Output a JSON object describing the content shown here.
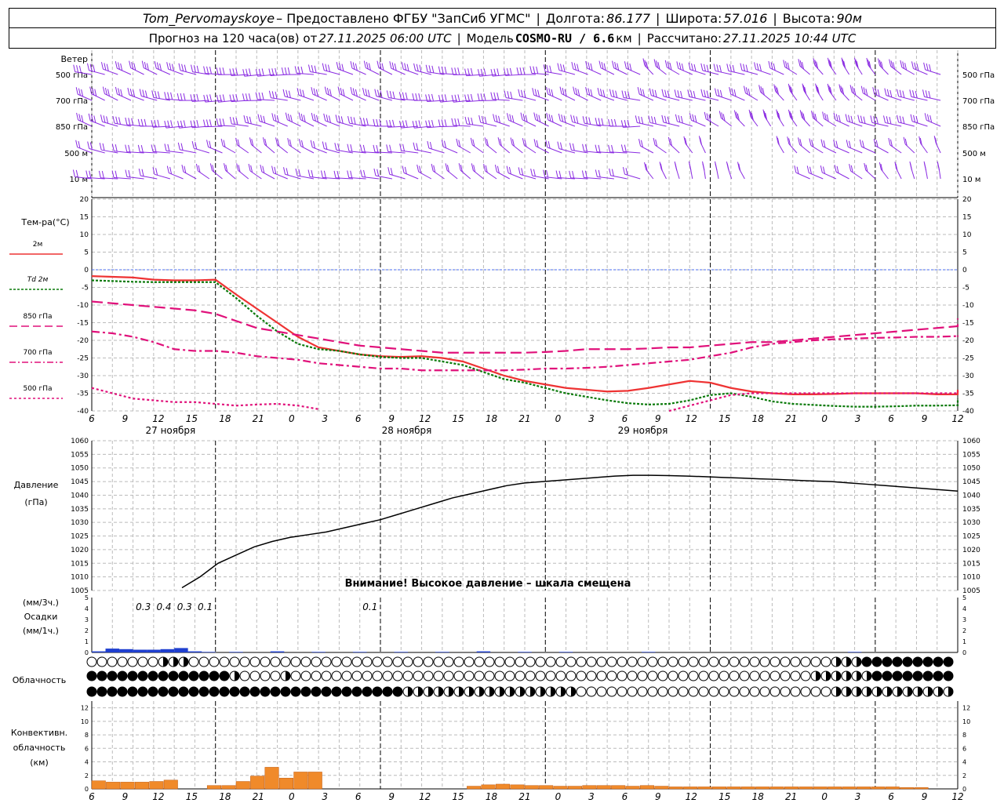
{
  "header": {
    "station": "Tom_Pervomayskoye",
    "provided_by": "– Предоставлено ФГБУ \"ЗапСиб УГМС\"",
    "lon_label": "Долгота:",
    "lon": "86.177",
    "lat_label": "Широта:",
    "lat": "57.016",
    "alt_label": "Высота:",
    "alt": "90м",
    "forecast_label": "Прогноз на 120 часа(ов) от",
    "run": "27.11.2025 06:00 UTC",
    "model_label": "Модель",
    "model": "COSMO-RU / 6.6",
    "model_unit": "км",
    "calc_label": "Рассчитано:",
    "calc": "27.11.2025 10:44 UTC"
  },
  "wind_panel": {
    "title": "Ветер",
    "levels": [
      "500 гПа",
      "700 гПа",
      "850 гПа",
      "500 м",
      "10 м"
    ]
  },
  "colors": {
    "wind": "#8a2be2",
    "t2m": "#ee3333",
    "td2m": "#0a7a0a",
    "t850": "#e0107a",
    "t700": "#e0107a",
    "t500": "#e0107a",
    "zero_line": "#4a6cf0",
    "pressure": "#000000",
    "precip": "#1f3fcf",
    "convective": "#f08a2a"
  },
  "axes": {
    "hour_ticks": [
      "6",
      "9",
      "12",
      "15",
      "18",
      "21",
      "0",
      "3",
      "6",
      "9",
      "12",
      "15",
      "18",
      "21",
      "0",
      "3",
      "6",
      "9",
      "12",
      "15",
      "18",
      "21",
      "0",
      "3",
      "6",
      "9",
      "12"
    ],
    "day_labels": [
      "27 ноября",
      "28 ноября",
      "29 ноября"
    ]
  },
  "temperature_panel": {
    "title": "Тем-ра(°С)",
    "legend": [
      {
        "label": "2м",
        "prefix": ""
      },
      {
        "label": "2м",
        "prefix": "Td"
      },
      {
        "label": "850 гПа",
        "prefix": ""
      },
      {
        "label": "700 гПа",
        "prefix": ""
      },
      {
        "label": "500 гПа",
        "prefix": ""
      }
    ]
  },
  "pressure_panel": {
    "title": "Давление",
    "unit": "(гПа)",
    "warning": "Внимание! Высокое давление – шкала смещена"
  },
  "precip_panel": {
    "unit_top": "(мм/3ч.)",
    "title": "Осадки",
    "unit_bottom": "(мм/1ч.)",
    "amounts": [
      {
        "hour": 9,
        "text": "0.3"
      },
      {
        "hour": 12,
        "text": "0.4"
      },
      {
        "hour": 15,
        "text": "0.3"
      },
      {
        "hour": 18,
        "text": "0.1"
      },
      {
        "hour": 42,
        "text": "0.1"
      }
    ]
  },
  "cloud_panel": {
    "title": "Облачность"
  },
  "convective_panel": {
    "title_lines": [
      "Конвективн.",
      "облачность",
      "(км)"
    ]
  },
  "chart_data": [
    {
      "type": "line",
      "title": "Тем-ра(°С)",
      "x_unit": "hours since 27.11.2025 06:00 UTC",
      "ylim": [
        -40,
        20
      ],
      "yticks": [
        -40,
        -35,
        -30,
        -25,
        -20,
        -15,
        -10,
        -5,
        0,
        5,
        10,
        15,
        20
      ],
      "series": [
        {
          "name": "2м",
          "x": [
            0,
            3,
            6,
            9,
            12,
            15,
            18,
            21,
            24,
            27,
            30,
            33,
            36,
            39,
            42,
            45,
            48,
            51,
            54,
            57,
            60,
            63,
            66,
            69,
            72,
            75,
            78,
            81,
            84,
            87,
            90,
            93,
            96,
            99,
            102,
            105,
            108,
            111,
            114,
            117,
            120,
            123,
            126,
            129,
            132,
            135,
            138,
            141,
            144
          ],
          "y": [
            -1.8,
            -2,
            -2.2,
            -2.8,
            -3,
            -3,
            -2.8,
            -7,
            -11,
            -15,
            -19,
            -22,
            -23,
            -24,
            -24.5,
            -24.7,
            -24.5,
            -25,
            -26,
            -28,
            -30,
            -31.5,
            -32.5,
            -33.5,
            -34,
            -34.5,
            -34.3,
            -33.5,
            -32.5,
            -31.5,
            -32,
            -33.5,
            -34.5,
            -35,
            -35.3,
            -35.3,
            -35.2,
            -35,
            -35,
            -35,
            -35,
            -35.3,
            -35.3,
            -35.5,
            -35.5,
            -35.2,
            -35,
            -34.5,
            -34
          ]
        },
        {
          "name": "Td 2м",
          "x": [
            0,
            3,
            6,
            9,
            12,
            15,
            18,
            21,
            24,
            27,
            30,
            33,
            36,
            39,
            42,
            45,
            48,
            51,
            54,
            57,
            60,
            63,
            66,
            69,
            72,
            75,
            78,
            81,
            84,
            87,
            90,
            93,
            96,
            99,
            102,
            105,
            108,
            111,
            114,
            117,
            120,
            123,
            126,
            129,
            132,
            135,
            138,
            141,
            144
          ],
          "y": [
            -3,
            -3.2,
            -3.4,
            -3.5,
            -3.5,
            -3.5,
            -3.5,
            -8,
            -13,
            -17.5,
            -21,
            -22.5,
            -23,
            -24,
            -24.7,
            -25,
            -25,
            -26,
            -27,
            -29,
            -31,
            -32,
            -33.5,
            -35,
            -36,
            -37,
            -37.8,
            -38.2,
            -38,
            -37,
            -35.5,
            -35,
            -36,
            -37.3,
            -38,
            -38.3,
            -38.6,
            -38.8,
            -38.8,
            -38.7,
            -38.5,
            -38.5,
            -38.4,
            -38.3,
            -38.2,
            -38,
            -37.6,
            -37,
            -36.5
          ]
        },
        {
          "name": "850 гПа",
          "x": [
            0,
            3,
            6,
            9,
            12,
            15,
            18,
            21,
            24,
            27,
            30,
            33,
            36,
            39,
            42,
            45,
            48,
            51,
            54,
            57,
            60,
            63,
            66,
            69,
            72,
            75,
            78,
            81,
            84,
            87,
            90,
            93,
            96,
            99,
            102,
            105,
            108,
            111,
            114,
            117,
            120,
            123,
            126,
            129,
            132,
            135,
            138,
            141,
            144
          ],
          "y": [
            -9,
            -9.5,
            -10,
            -10.5,
            -11,
            -11.5,
            -12.5,
            -14.5,
            -16.5,
            -17.5,
            -18.5,
            -19.5,
            -20.5,
            -21.5,
            -22,
            -22.5,
            -23,
            -23.5,
            -23.5,
            -23.5,
            -23.5,
            -23.5,
            -23.3,
            -23,
            -22.5,
            -22.5,
            -22.5,
            -22.3,
            -22,
            -22,
            -21.5,
            -21,
            -20.5,
            -20.5,
            -20,
            -19.5,
            -19,
            -18.5,
            -18,
            -17.5,
            -17,
            -16.5,
            -16,
            -15.5,
            -15,
            -14.5,
            -14.2,
            -14,
            -13.8
          ]
        },
        {
          "name": "700 гПа",
          "x": [
            0,
            3,
            6,
            9,
            12,
            15,
            18,
            21,
            24,
            27,
            30,
            33,
            36,
            39,
            42,
            45,
            48,
            51,
            54,
            57,
            60,
            63,
            66,
            69,
            72,
            75,
            78,
            81,
            84,
            87,
            90,
            93,
            96,
            99,
            102,
            105,
            108,
            111,
            114,
            117,
            120,
            123,
            126,
            129,
            132,
            135,
            138,
            141,
            144
          ],
          "y": [
            -17.5,
            -18,
            -19,
            -20.5,
            -22.5,
            -23,
            -23,
            -23.5,
            -24.5,
            -25,
            -25.5,
            -26.5,
            -27,
            -27.5,
            -28,
            -28,
            -28.5,
            -28.5,
            -28.5,
            -28.5,
            -28.5,
            -28.3,
            -28,
            -28,
            -27.8,
            -27.5,
            -27,
            -26.5,
            -26,
            -25.5,
            -24.5,
            -23.5,
            -22,
            -21,
            -20.5,
            -20,
            -19.7,
            -19.5,
            -19.3,
            -19.2,
            -19,
            -19,
            -18.8,
            -18.7,
            -18.5,
            -18.5,
            -18.6,
            -18.8,
            -19
          ]
        },
        {
          "name": "500 гПа",
          "x": [
            0,
            3,
            6,
            9,
            12,
            15,
            18,
            21,
            24,
            27,
            30,
            33,
            36,
            39,
            42,
            45,
            48,
            51,
            54,
            57,
            60,
            63,
            66,
            69,
            72,
            75,
            78,
            81,
            84,
            87,
            90,
            93,
            96,
            99,
            102,
            105,
            108,
            111,
            114,
            117,
            120,
            123,
            126,
            129,
            132,
            135,
            138,
            141,
            144
          ],
          "y": [
            -33.5,
            -35,
            -36.5,
            -37,
            -37.5,
            -37.5,
            -38,
            -38.5,
            -38.2,
            -38,
            -38.5,
            -39.5,
            -40.5,
            -41,
            -41.5,
            -42,
            -42,
            -42,
            -42,
            -42,
            -42,
            -42,
            -42,
            -42,
            -42,
            -42,
            -41.5,
            -41,
            -40,
            -38.5,
            -37,
            -35.5,
            -35,
            -35,
            -35,
            -35,
            -35,
            -35,
            -35,
            -35,
            -35,
            -35,
            -35,
            -35,
            -35,
            -35,
            -35,
            -34.8,
            -34.5
          ]
        }
      ]
    },
    {
      "type": "line",
      "title": "Давление",
      "ylabel": "(гПа)",
      "ylim": [
        1005,
        1060
      ],
      "yticks": [
        1005,
        1010,
        1015,
        1020,
        1025,
        1030,
        1035,
        1040,
        1045,
        1050,
        1055,
        1060
      ],
      "series": [
        {
          "name": "pressure",
          "x": [
            0,
            3,
            6,
            9,
            12,
            15,
            18,
            21,
            24,
            27,
            30,
            33,
            36,
            39,
            42,
            45,
            48,
            51,
            54,
            57,
            60,
            63,
            66,
            69,
            72,
            75,
            78,
            81,
            84,
            87,
            90,
            93,
            96,
            99,
            102,
            105,
            108,
            111,
            114,
            117,
            120,
            123,
            126,
            129,
            132,
            135,
            138,
            141,
            144
          ],
          "y": [
            985,
            990,
            995,
            1000,
            1003,
            1006,
            1010,
            1015,
            1018,
            1021,
            1023,
            1024.5,
            1025.5,
            1026.5,
            1028,
            1029.5,
            1031,
            1033,
            1035,
            1037,
            1039,
            1040.5,
            1042,
            1043.5,
            1044.5,
            1045,
            1045.5,
            1046,
            1046.5,
            1047,
            1047.3,
            1047.3,
            1047.2,
            1047,
            1046.8,
            1046.5,
            1046.3,
            1046,
            1045.8,
            1045.5,
            1045.2,
            1045,
            1044.5,
            1044,
            1043.5,
            1043,
            1042.5,
            1042,
            1041.5
          ]
        }
      ]
    },
    {
      "type": "bar",
      "title": "Осадки",
      "ylabel": "(мм/1ч.)",
      "ylim": [
        0,
        5
      ],
      "x": [
        1,
        3,
        5,
        7,
        9,
        11,
        13,
        15,
        17,
        21,
        27,
        33,
        39,
        45,
        51,
        57,
        63,
        69,
        81,
        111
      ],
      "values": [
        0.1,
        0.35,
        0.3,
        0.25,
        0.25,
        0.3,
        0.4,
        0.1,
        0.05,
        0.05,
        0.1,
        0.05,
        0.05,
        0.05,
        0.05,
        0.1,
        0.05,
        0.05,
        0.05,
        0.05
      ]
    },
    {
      "type": "bar",
      "title": "Конвективн. облачность",
      "ylabel": "(км)",
      "ylim": [
        0,
        12
      ],
      "yticks": [
        0,
        2,
        4,
        6,
        8,
        10,
        12
      ],
      "x": [
        0,
        2,
        4,
        6,
        8,
        10,
        12,
        14,
        16,
        18,
        20,
        22,
        24,
        26,
        28,
        30,
        32,
        34,
        36,
        38,
        40,
        42,
        44,
        46,
        48,
        50,
        52,
        54,
        56,
        58,
        60,
        62,
        64,
        66,
        68,
        70,
        72,
        74,
        76,
        78,
        80,
        82,
        84,
        86,
        88,
        90,
        92,
        94,
        96,
        98,
        100,
        102,
        104,
        106,
        108,
        110,
        112,
        114,
        116,
        118,
        120
      ],
      "values": [
        1.2,
        1.0,
        1.0,
        1.0,
        1.1,
        1.3,
        0,
        0,
        0.5,
        0.5,
        1.1,
        1.9,
        3.2,
        1.6,
        2.5,
        2.5,
        0,
        0,
        0,
        0,
        0,
        0,
        0,
        0,
        0,
        0,
        0.4,
        0.6,
        0.7,
        0.6,
        0.5,
        0.5,
        0.4,
        0.4,
        0.5,
        0.5,
        0.5,
        0.4,
        0.5,
        0.4,
        0.3,
        0.3,
        0.3,
        0.3,
        0.3,
        0.3,
        0.3,
        0.3,
        0.3,
        0.3,
        0.3,
        0.3,
        0.3,
        0.3,
        0.3,
        0.3,
        0.2,
        0.2,
        0,
        0,
        0
      ]
    }
  ]
}
